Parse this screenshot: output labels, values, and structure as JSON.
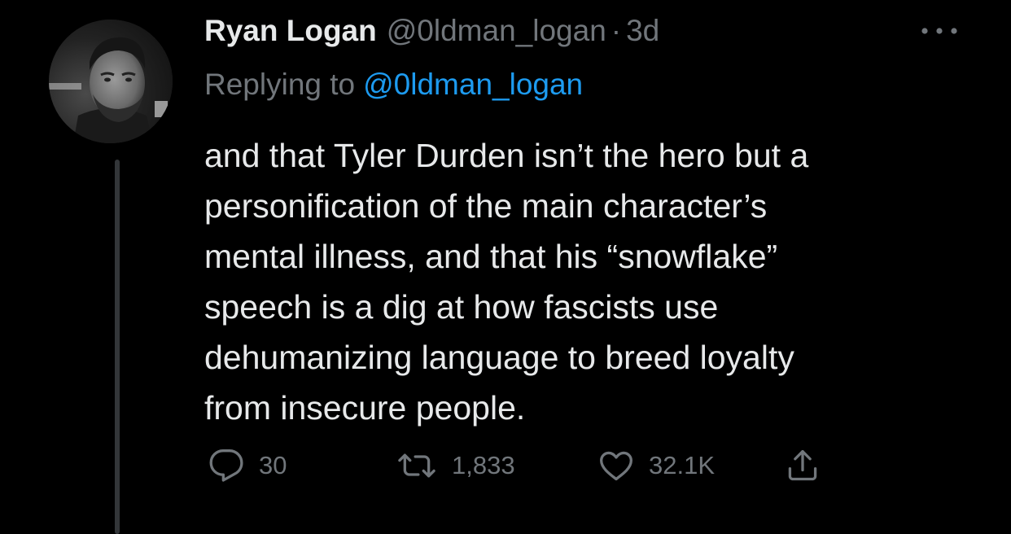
{
  "tweet": {
    "author_name": "Ryan Logan",
    "author_handle": "@0ldman_logan",
    "separator": "·",
    "time_ago": "3d",
    "replying_label": "Replying to",
    "replying_to": "@0ldman_logan",
    "text_lines": [
      "and that Tyler Durden isn’t the hero but a",
      "personification of the main character’s",
      "mental illness, and that his “snowflake”",
      "speech is a dig at how fascists use",
      "dehumanizing language to breed loyalty",
      "from insecure people."
    ],
    "stats": {
      "replies": "30",
      "retweets": "1,833",
      "likes": "32.1K"
    }
  },
  "colors": {
    "background": "#000000",
    "primary_text": "#e7e9ea",
    "secondary_text": "#71767b",
    "link": "#1d9bf0",
    "thread_line": "#333639"
  },
  "icons": {
    "more": "more-horizontal-icon",
    "reply": "speech-bubble-icon",
    "retweet": "retweet-arrows-icon",
    "like": "heart-icon",
    "share": "share-upload-icon"
  }
}
